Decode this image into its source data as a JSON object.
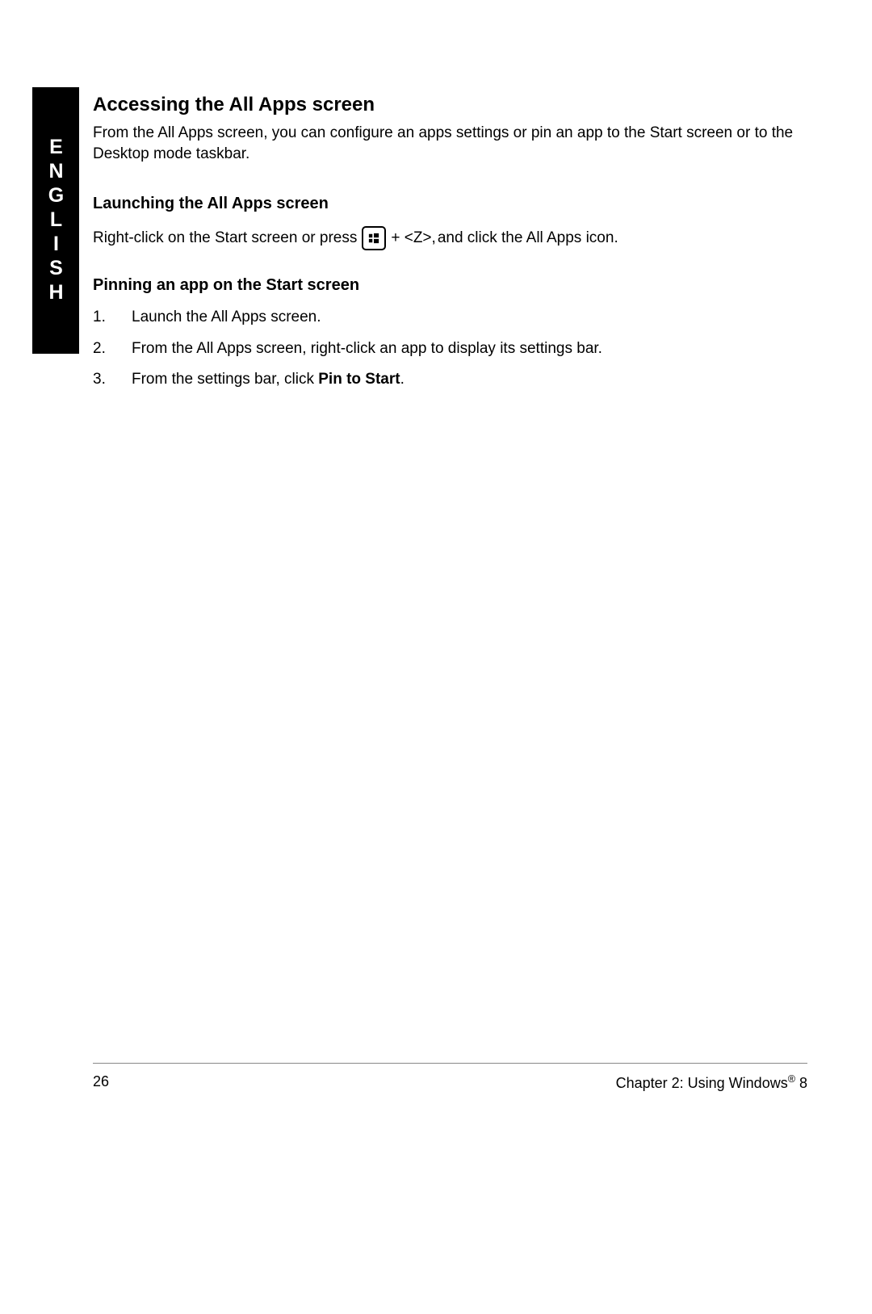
{
  "language_label": "ENGLISH",
  "section": {
    "title": "Accessing the All Apps screen",
    "intro": "From the All Apps screen, you can configure an apps settings or pin an app to the Start screen or to the Desktop mode taskbar."
  },
  "launching": {
    "title": "Launching the All Apps screen",
    "pre": "Right-click on the Start screen or press ",
    "key_combo": " + <Z>, ",
    "post": "and click the All Apps icon."
  },
  "pinning": {
    "title": "Pinning an app on the Start screen",
    "steps": [
      "Launch the All Apps screen.",
      "From the All Apps screen, right-click an app to display its settings bar."
    ],
    "step3_pre": "From the settings bar, click ",
    "step3_bold": "Pin to Start",
    "step3_post": "."
  },
  "step_numbers": {
    "n1": "1.",
    "n2": "2.",
    "n3": "3."
  },
  "footer": {
    "page_number": "26",
    "chapter_pre": "Chapter 2: Using Windows",
    "reg": "®",
    "chapter_post": " 8"
  }
}
